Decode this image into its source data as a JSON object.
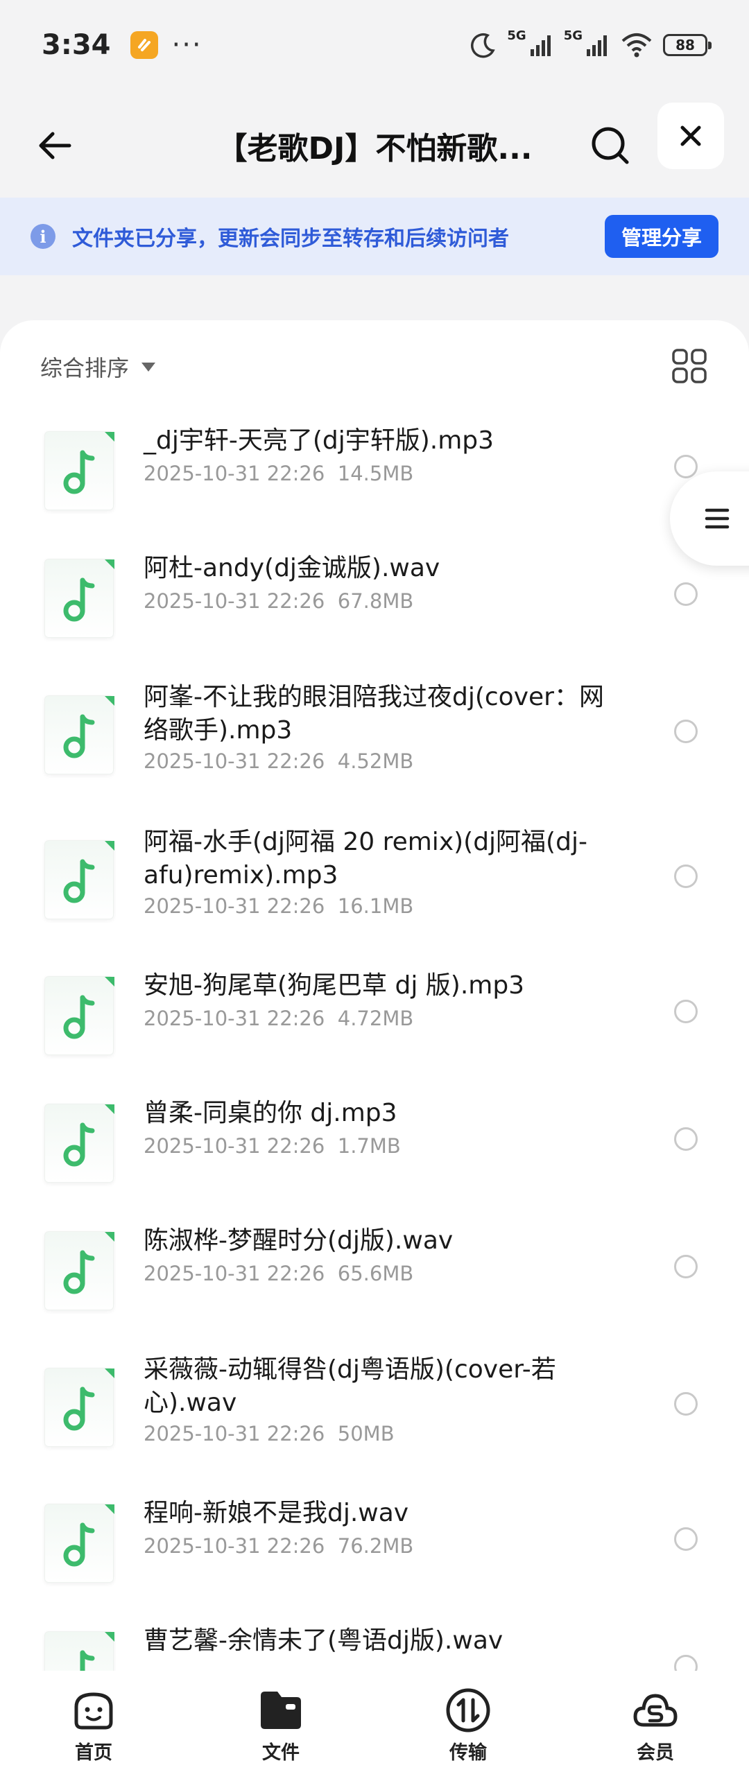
{
  "status_bar": {
    "time": "3:34",
    "dots": "···",
    "net1": "5G",
    "net2": "5G",
    "battery": "88"
  },
  "header": {
    "title": "【老歌DJ】不怕新歌..."
  },
  "banner": {
    "text": "文件夹已分享，更新会同步至转存和后续访问者",
    "button": "管理分享",
    "info_glyph": "i"
  },
  "sort": {
    "label": "综合排序"
  },
  "files": [
    {
      "name": "_dj宇轩-天亮了(dj宇轩版).mp3",
      "date": "2025-10-31 22:26",
      "size": "14.5MB"
    },
    {
      "name": "阿杜-andy(dj金诚版).wav",
      "date": "2025-10-31 22:26",
      "size": "67.8MB"
    },
    {
      "name": "阿峯-不让我的眼泪陪我过夜dj(cover：网络歌手).mp3",
      "date": "2025-10-31 22:26",
      "size": "4.52MB"
    },
    {
      "name": "阿福-水手(dj阿福 20 remix)(dj阿福(dj-afu)remix).mp3",
      "date": "2025-10-31 22:26",
      "size": "16.1MB"
    },
    {
      "name": "安旭-狗尾草(狗尾巴草 dj 版).mp3",
      "date": "2025-10-31 22:26",
      "size": "4.72MB"
    },
    {
      "name": "曾柔-同桌的你 dj.mp3",
      "date": "2025-10-31 22:26",
      "size": "1.7MB"
    },
    {
      "name": "陈淑桦-梦醒时分(dj版).wav",
      "date": "2025-10-31 22:26",
      "size": "65.6MB"
    },
    {
      "name": "采薇薇-动辄得咎(dj粤语版)(cover-若心).wav",
      "date": "2025-10-31 22:26",
      "size": "50MB"
    },
    {
      "name": "程响-新娘不是我dj.wav",
      "date": "2025-10-31 22:26",
      "size": "76.2MB"
    },
    {
      "name": "曹艺馨-余情未了(粤语dj版).wav",
      "date": "",
      "size": ""
    }
  ],
  "bottom_nav": [
    {
      "label": "首页",
      "icon": "home-face-icon"
    },
    {
      "label": "文件",
      "icon": "folder-icon"
    },
    {
      "label": "传输",
      "icon": "transfer-icon"
    },
    {
      "label": "会员",
      "icon": "vip-icon"
    }
  ],
  "colors": {
    "accent": "#1f5ff0",
    "banner_bg": "#e6ecfb",
    "banner_text": "#2f5bd8",
    "music_green": "#3dbb6c"
  }
}
